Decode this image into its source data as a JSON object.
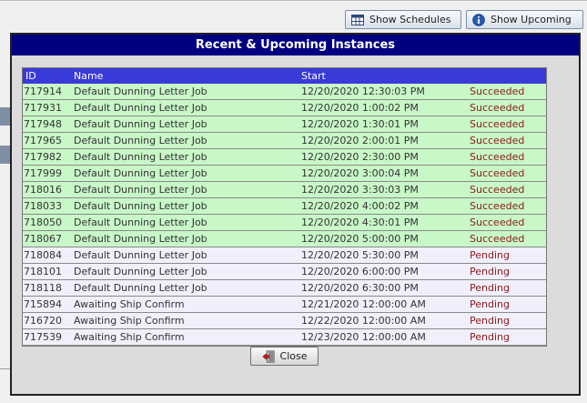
{
  "toolbar": {
    "show_schedules_label": "Show Schedules",
    "show_upcoming_label": "Show Upcoming"
  },
  "dialog": {
    "title": "Recent & Upcoming Instances",
    "close_label": "Close"
  },
  "grid": {
    "columns": {
      "id": "ID",
      "name": "Name",
      "start": "Start"
    },
    "rows": [
      {
        "id": "717914",
        "name": "Default Dunning Letter Job",
        "start": "12/20/2020 12:30:03 PM",
        "status": "Succeeded"
      },
      {
        "id": "717931",
        "name": "Default Dunning Letter Job",
        "start": "12/20/2020 1:00:02 PM",
        "status": "Succeeded"
      },
      {
        "id": "717948",
        "name": "Default Dunning Letter Job",
        "start": "12/20/2020 1:30:01 PM",
        "status": "Succeeded"
      },
      {
        "id": "717965",
        "name": "Default Dunning Letter Job",
        "start": "12/20/2020 2:00:01 PM",
        "status": "Succeeded"
      },
      {
        "id": "717982",
        "name": "Default Dunning Letter Job",
        "start": "12/20/2020 2:30:00 PM",
        "status": "Succeeded"
      },
      {
        "id": "717999",
        "name": "Default Dunning Letter Job",
        "start": "12/20/2020 3:00:04 PM",
        "status": "Succeeded"
      },
      {
        "id": "718016",
        "name": "Default Dunning Letter Job",
        "start": "12/20/2020 3:30:03 PM",
        "status": "Succeeded"
      },
      {
        "id": "718033",
        "name": "Default Dunning Letter Job",
        "start": "12/20/2020 4:00:02 PM",
        "status": "Succeeded"
      },
      {
        "id": "718050",
        "name": "Default Dunning Letter Job",
        "start": "12/20/2020 4:30:01 PM",
        "status": "Succeeded"
      },
      {
        "id": "718067",
        "name": "Default Dunning Letter Job",
        "start": "12/20/2020 5:00:00 PM",
        "status": "Succeeded"
      },
      {
        "id": "718084",
        "name": "Default Dunning Letter Job",
        "start": "12/20/2020 5:30:00 PM",
        "status": "Pending"
      },
      {
        "id": "718101",
        "name": "Default Dunning Letter Job",
        "start": "12/20/2020 6:00:00 PM",
        "status": "Pending"
      },
      {
        "id": "718118",
        "name": "Default Dunning Letter Job",
        "start": "12/20/2020 6:30:00 PM",
        "status": "Pending"
      },
      {
        "id": "715894",
        "name": "Awaiting Ship Confirm",
        "start": "12/21/2020 12:00:00 AM",
        "status": "Pending"
      },
      {
        "id": "716720",
        "name": "Awaiting Ship Confirm",
        "start": "12/22/2020 12:00:00 AM",
        "status": "Pending"
      },
      {
        "id": "717539",
        "name": "Awaiting Ship Confirm",
        "start": "12/23/2020 12:00:00 AM",
        "status": "Pending"
      }
    ]
  },
  "colors": {
    "title_bar": "#000080",
    "header": "#3a3ad8",
    "succeeded_row": "#c8f7c8",
    "pending_row": "#f0effc",
    "status_text": "#8b1a1a"
  },
  "icons": {
    "show_schedules": "schedule-grid-icon",
    "show_upcoming": "info-icon",
    "close": "exit-door-icon"
  }
}
